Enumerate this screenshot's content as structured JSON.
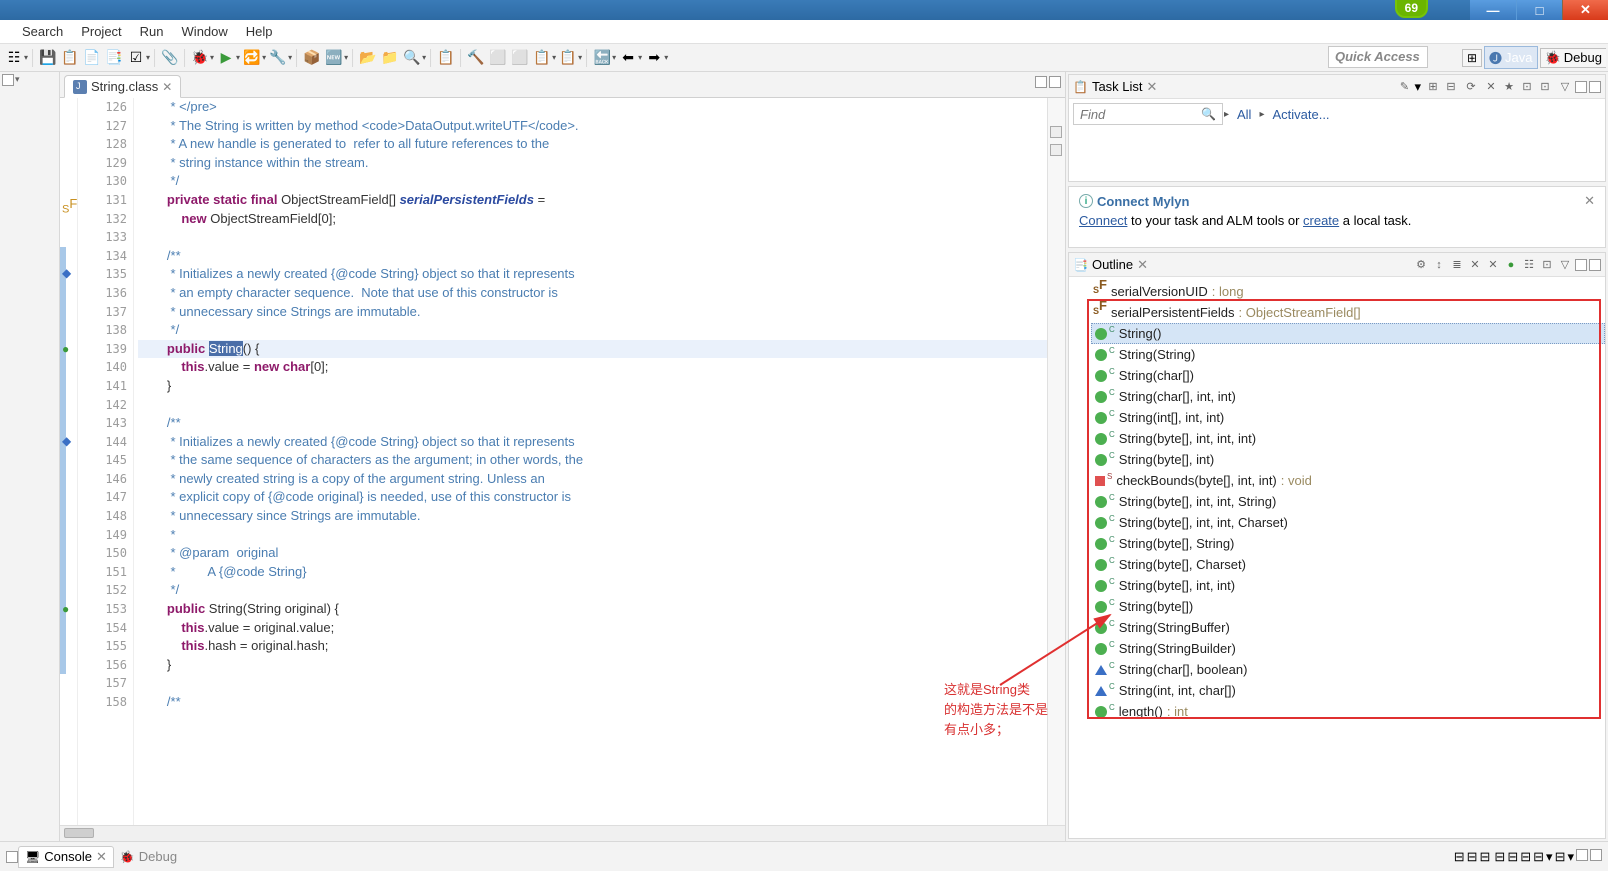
{
  "window": {
    "badge": "69"
  },
  "menu": [
    "Search",
    "Project",
    "Run",
    "Window",
    "Help"
  ],
  "quick_access": "Quick Access",
  "perspectives": [
    {
      "name": "open",
      "label": ""
    },
    {
      "name": "java",
      "label": "Java",
      "selected": true
    },
    {
      "name": "debug",
      "label": "Debug"
    }
  ],
  "editor": {
    "tab_title": "String.class",
    "first_line": 126,
    "highlighted_line": 139,
    "lines": [
      {
        "n": 126,
        "t": "         * </pre>",
        "c": "cmt"
      },
      {
        "n": 127,
        "t": "         * The String is written by method <code>DataOutput.writeUTF</code>.",
        "c": "cmt"
      },
      {
        "n": 128,
        "t": "         * A new handle is generated to  refer to all future references to the",
        "c": "cmt"
      },
      {
        "n": 129,
        "t": "         * string instance within the stream.",
        "c": "cmt"
      },
      {
        "n": 130,
        "t": "         */",
        "c": "cmt"
      },
      {
        "n": 131,
        "html": "        <span class='kw'>private static final</span> ObjectStreamField[] <span class='it'>serialPersistentFields</span> ="
      },
      {
        "n": 132,
        "html": "            <span class='kw'>new</span> ObjectStreamField[0];"
      },
      {
        "n": 133,
        "t": ""
      },
      {
        "n": 134,
        "t": "        /**",
        "c": "cmt"
      },
      {
        "n": 135,
        "t": "         * Initializes a newly created {@code String} object so that it represents",
        "c": "cmt"
      },
      {
        "n": 136,
        "t": "         * an empty character sequence.  Note that use of this constructor is",
        "c": "cmt"
      },
      {
        "n": 137,
        "t": "         * unnecessary since Strings are immutable.",
        "c": "cmt"
      },
      {
        "n": 138,
        "t": "         */",
        "c": "cmt"
      },
      {
        "n": 139,
        "html": "        <span class='kw'>public</span> <span class='sel'>String</span>() {"
      },
      {
        "n": 140,
        "html": "            <span class='kw2'>this</span>.value = <span class='kw'>new char</span>[0];"
      },
      {
        "n": 141,
        "t": "        }"
      },
      {
        "n": 142,
        "t": ""
      },
      {
        "n": 143,
        "t": "        /**",
        "c": "cmt"
      },
      {
        "n": 144,
        "t": "         * Initializes a newly created {@code String} object so that it represents",
        "c": "cmt"
      },
      {
        "n": 145,
        "t": "         * the same sequence of characters as the argument; in other words, the",
        "c": "cmt"
      },
      {
        "n": 146,
        "t": "         * newly created string is a copy of the argument string. Unless an",
        "c": "cmt"
      },
      {
        "n": 147,
        "t": "         * explicit copy of {@code original} is needed, use of this constructor is",
        "c": "cmt"
      },
      {
        "n": 148,
        "t": "         * unnecessary since Strings are immutable.",
        "c": "cmt"
      },
      {
        "n": 149,
        "t": "         *",
        "c": "cmt"
      },
      {
        "n": 150,
        "t": "         * @param  original",
        "c": "cmt"
      },
      {
        "n": 151,
        "t": "         *         A {@code String}",
        "c": "cmt"
      },
      {
        "n": 152,
        "t": "         */",
        "c": "cmt"
      },
      {
        "n": 153,
        "html": "        <span class='kw'>public</span> String(String original) {"
      },
      {
        "n": 154,
        "html": "            <span class='kw2'>this</span>.value = original.value;"
      },
      {
        "n": 155,
        "html": "            <span class='kw2'>this</span>.hash = original.hash;"
      },
      {
        "n": 156,
        "t": "        }"
      },
      {
        "n": 157,
        "t": ""
      },
      {
        "n": 158,
        "t": "        /**",
        "c": "cmt"
      }
    ]
  },
  "task_list": {
    "title": "Task List",
    "find": "Find",
    "all": "All",
    "activate": "Activate..."
  },
  "mylyn": {
    "title": "Connect Mylyn",
    "before": "Connect",
    "mid": " to your task and ALM tools or ",
    "create": "create",
    "after": " a local task."
  },
  "outline": {
    "title": "Outline",
    "items": [
      {
        "icon": "sf",
        "label": "serialVersionUID",
        "ret": " : long"
      },
      {
        "icon": "sf",
        "label": "serialPersistentFields",
        "ret": " : ObjectStreamField[]"
      },
      {
        "icon": "c",
        "label": "String()",
        "selected": true
      },
      {
        "icon": "c",
        "label": "String(String)"
      },
      {
        "icon": "c",
        "label": "String(char[])"
      },
      {
        "icon": "c",
        "label": "String(char[], int, int)"
      },
      {
        "icon": "c",
        "label": "String(int[], int, int)"
      },
      {
        "icon": "c",
        "label": "String(byte[], int, int, int)"
      },
      {
        "icon": "c",
        "label": "String(byte[], int)"
      },
      {
        "icon": "priv",
        "label": "checkBounds(byte[], int, int)",
        "ret": " : void"
      },
      {
        "icon": "c",
        "label": "String(byte[], int, int, String)"
      },
      {
        "icon": "c",
        "label": "String(byte[], int, int, Charset)"
      },
      {
        "icon": "c",
        "label": "String(byte[], String)"
      },
      {
        "icon": "c",
        "label": "String(byte[], Charset)"
      },
      {
        "icon": "c",
        "label": "String(byte[], int, int)"
      },
      {
        "icon": "c",
        "label": "String(byte[])"
      },
      {
        "icon": "c",
        "label": "String(StringBuffer)"
      },
      {
        "icon": "c",
        "label": "String(StringBuilder)"
      },
      {
        "icon": "tri",
        "label": "String(char[], boolean)"
      },
      {
        "icon": "tri",
        "label": "String(int, int, char[])"
      },
      {
        "icon": "pub",
        "label": "length()",
        "ret": " : int"
      }
    ]
  },
  "annotation": {
    "l1": "这就是String类",
    "l2": "的构造方法是不是",
    "l3": "有点小多；"
  },
  "bottom": {
    "console": "Console",
    "debug": "Debug"
  }
}
